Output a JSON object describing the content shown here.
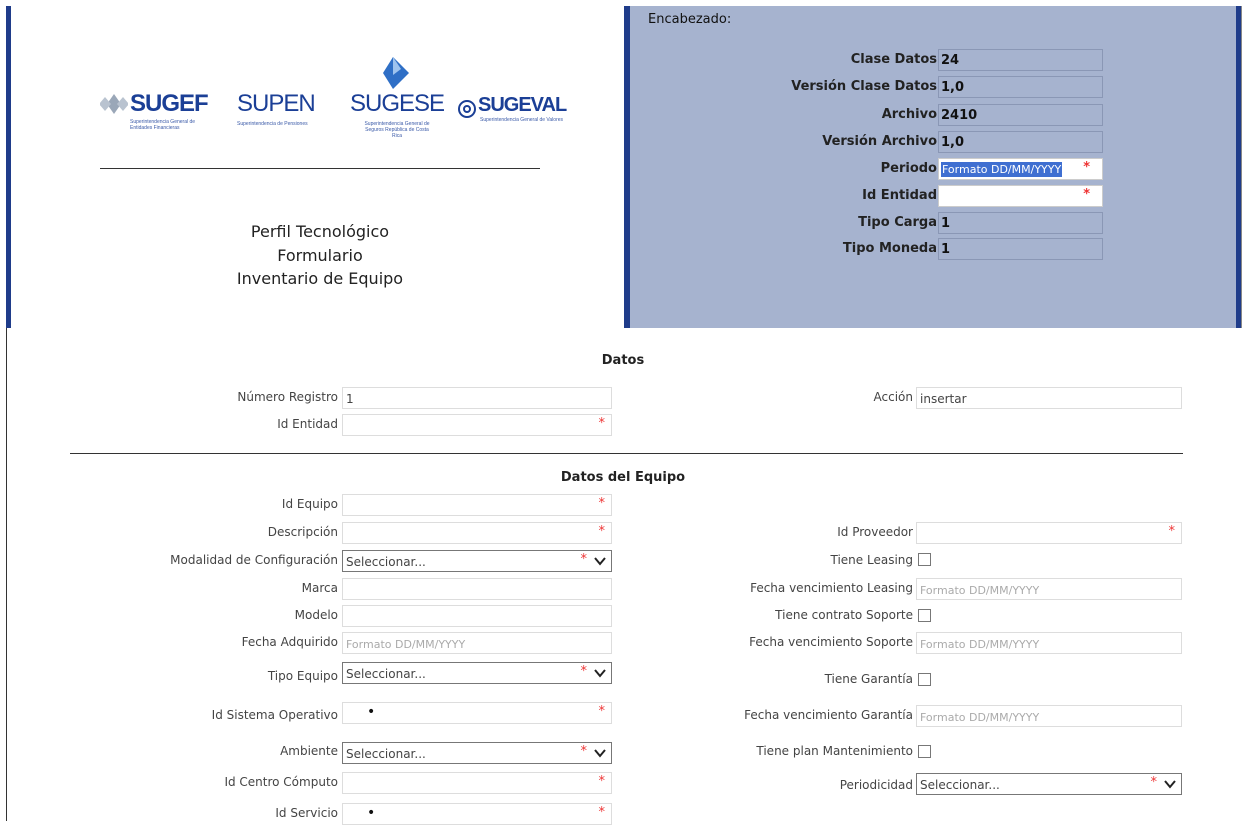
{
  "brand": {
    "logos": [
      "SUGEF",
      "SUPEN",
      "SUGESE",
      "SUGEVAL"
    ],
    "logo_subtitles": {
      "sugef": "Superintendencia General de Entidades Financieras",
      "supen": "Superintendencia de Pensiones",
      "sugese": "Superintendencia General de Seguros República de Costa Rica",
      "sugeval": "Superintendencia General de Valores"
    },
    "title_lines": [
      "Perfil Tecnológico",
      "Formulario",
      "Inventario de Equipo"
    ]
  },
  "encabezado": {
    "title": "Encabezado:",
    "rows": [
      {
        "label": "Clase Datos",
        "value": "24"
      },
      {
        "label": "Versión Clase Datos",
        "value": "1,0"
      },
      {
        "label": "Archivo",
        "value": "2410"
      },
      {
        "label": "Versión Archivo",
        "value": "1,0"
      },
      {
        "label": "Periodo",
        "placeholder": "Formato DD/MM/YYYY"
      },
      {
        "label": "Id Entidad",
        "value": ""
      },
      {
        "label": "Tipo Carga",
        "value": "1"
      },
      {
        "label": "Tipo Moneda",
        "value": "1"
      }
    ],
    "required_mark": "*"
  },
  "datos": {
    "title": "Datos",
    "numero_registro": {
      "label": "Número Registro",
      "value": "1"
    },
    "accion": {
      "label": "Acción",
      "value": "insertar"
    },
    "id_entidad": {
      "label": "Id Entidad",
      "value": ""
    }
  },
  "equipo": {
    "title": "Datos del Equipo",
    "select_placeholder": "Seleccionar...",
    "date_placeholder": "Formato DD/MM/YYYY",
    "left": {
      "id_equipo": "Id Equipo",
      "descripcion": "Descripción",
      "modalidad": "Modalidad de Configuración",
      "marca": "Marca",
      "modelo": "Modelo",
      "fecha_adquirido": "Fecha Adquirido",
      "tipo_equipo": "Tipo Equipo",
      "id_sistema_operativo": "Id Sistema Operativo",
      "ambiente": "Ambiente",
      "id_centro_computo": "Id Centro Cómputo",
      "id_servicio": "Id Servicio"
    },
    "right": {
      "id_proveedor": "Id Proveedor",
      "tiene_leasing": "Tiene Leasing",
      "fecha_venc_leasing": "Fecha vencimiento Leasing",
      "tiene_contrato_soporte": "Tiene contrato Soporte",
      "fecha_venc_soporte": "Fecha vencimiento Soporte",
      "tiene_garantia": "Tiene Garantía",
      "fecha_venc_garantia": "Fecha vencimiento Garantía",
      "tiene_plan_mant": "Tiene plan Mantenimiento",
      "periodicidad": "Periodicidad"
    },
    "bullet": "•"
  }
}
